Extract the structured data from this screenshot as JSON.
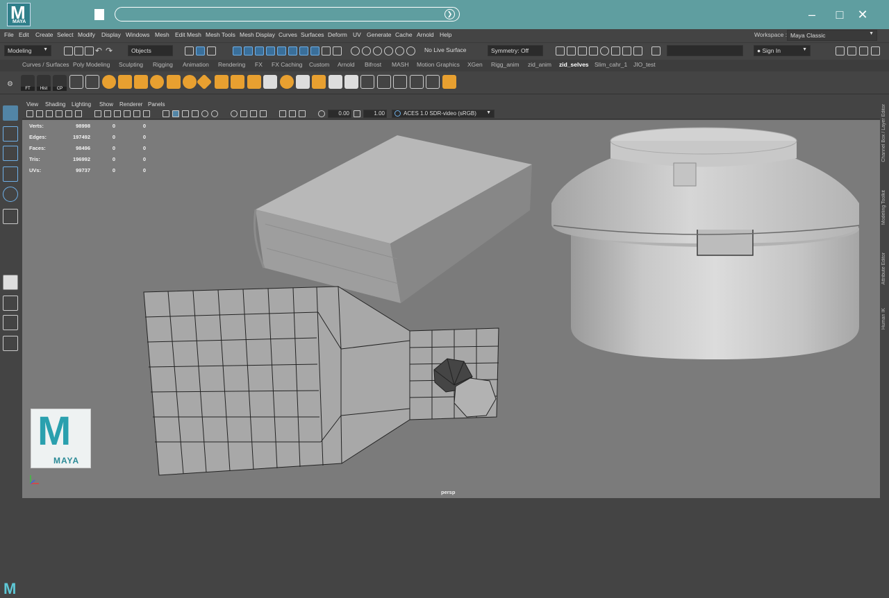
{
  "app": {
    "logo_label": "MAYA"
  },
  "menubar": {
    "items": [
      "File",
      "Edit",
      "Create",
      "Select",
      "Modify",
      "Display",
      "Windows",
      "Mesh",
      "Edit Mesh",
      "Mesh Tools",
      "Mesh Display",
      "Curves",
      "Surfaces",
      "Deform",
      "UV",
      "Generate",
      "Cache",
      "Arnold",
      "Help"
    ],
    "workspace_label": "Workspace :",
    "workspace_value": "Maya Classic"
  },
  "statusline": {
    "mode": "Modeling",
    "objects": "Objects",
    "live_surface": "No Live Surface",
    "symmetry": "Symmetry: Off",
    "sign_in": "Sign In"
  },
  "shelf_tabs": [
    "Curves / Surfaces",
    "Poly Modeling",
    "Sculpting",
    "Rigging",
    "Animation",
    "Rendering",
    "FX",
    "FX Caching",
    "Custom",
    "Arnold",
    "Bifrost",
    "MASH",
    "Motion Graphics",
    "XGen",
    "Rigg_anim",
    "zid_anim",
    "zid_selves",
    "Slim_cahr_1",
    "JIO_test"
  ],
  "active_shelf_tab": "zid_selves",
  "shelf_labels": {
    "ft": "FT",
    "hist": "Hist",
    "cp": "CP"
  },
  "panel_menu": [
    "View",
    "Shading",
    "Lighting",
    "Show",
    "Renderer",
    "Panels"
  ],
  "panel_bar": {
    "exposure": "0.00",
    "gamma": "1.00",
    "color_space": "ACES 1.0 SDR-video (sRGB)"
  },
  "hud": [
    {
      "label": "Verts:",
      "v1": "98998",
      "v2": "0",
      "v3": "0"
    },
    {
      "label": "Edges:",
      "v1": "197492",
      "v2": "0",
      "v3": "0"
    },
    {
      "label": "Faces:",
      "v1": "98496",
      "v2": "0",
      "v3": "0"
    },
    {
      "label": "Tris:",
      "v1": "196992",
      "v2": "0",
      "v3": "0"
    },
    {
      "label": "UVs:",
      "v1": "99737",
      "v2": "0",
      "v3": "0"
    }
  ],
  "camera": "persp",
  "overlay_logo": "MAYA",
  "right_tabs": [
    "Channel Box / Layer Editor",
    "Modeling Toolkit",
    "Attribute Editor",
    "Human IK"
  ],
  "colors": {
    "titlebar": "#5f9ea0",
    "viewport": "#7b7b7b",
    "accent": "#5285a6"
  }
}
